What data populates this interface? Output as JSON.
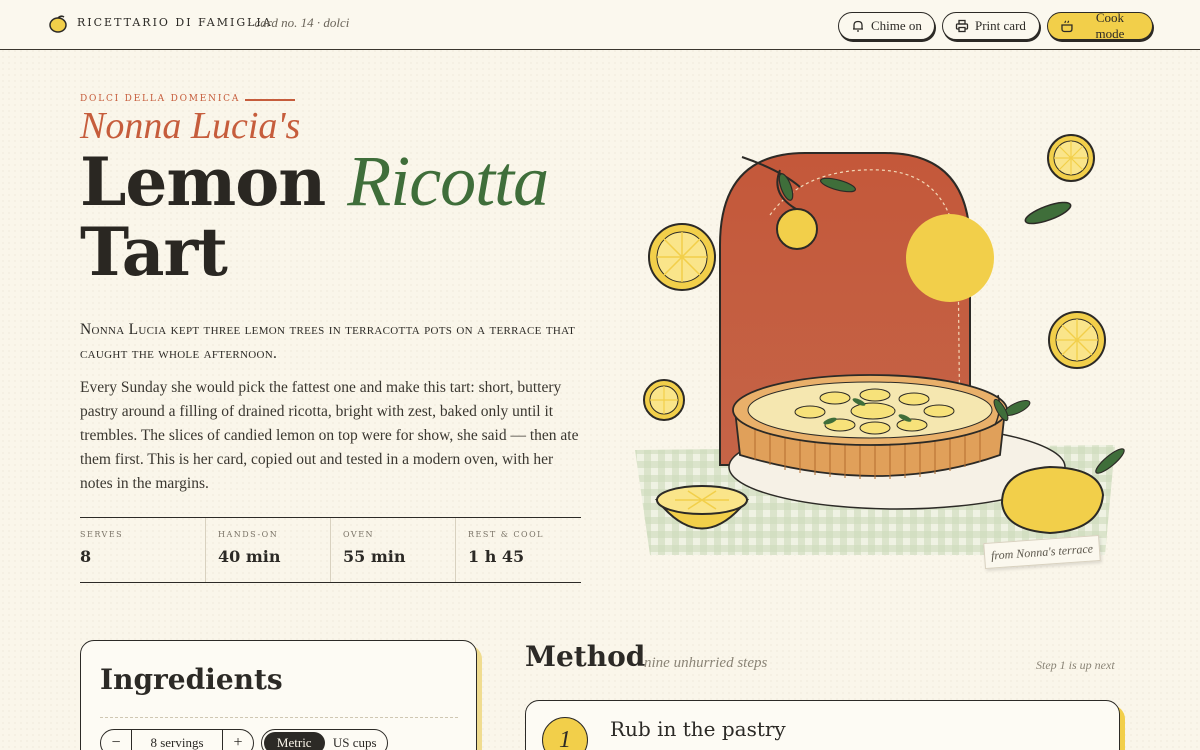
{
  "colors": {
    "accent_terracotta": "#c65d3c",
    "accent_green": "#3f6e3a",
    "lemon_yellow": "#f2cf4a",
    "ink": "#2c2a26",
    "paper": "#faf6ea"
  },
  "header": {
    "brand_icon": "lemon-icon",
    "brand_name": "RICETTARIO DI FAMIGLIA",
    "card_label": "· card no. 14 · dolci",
    "buttons": {
      "chime": {
        "label": "Chime on",
        "icon": "bell-icon"
      },
      "print": {
        "label": "Print card",
        "icon": "printer-icon"
      },
      "cook": {
        "label": "Cook mode",
        "icon": "pot-icon"
      }
    }
  },
  "hero": {
    "eyebrow": "DOLCI DELLA DOMENICA",
    "title_prefix": "Nonna Lucia's",
    "title_word1": "Lemon",
    "title_accent": "Ricotta",
    "title_word3": "Tart",
    "lead": "Nonna Lucia kept three lemon trees in terracotta pots on a terrace that caught the whole afternoon.",
    "body": "Every Sunday she would pick the fattest one and make this tart: short, buttery pastry around a filling of drained ricotta, bright with zest, baked only until it trembles. The slices of candied lemon on top were for show, she said — then ate them first. This is her card, copied out and tested in a modern oven, with her notes in the margins.",
    "illustration_caption": "from Nonna's terrace"
  },
  "stats": [
    {
      "label": "SERVES",
      "value": "8"
    },
    {
      "label": "HANDS-ON",
      "value": "40 min"
    },
    {
      "label": "OVEN",
      "value": "55 min"
    },
    {
      "label": "REST & COOL",
      "value": "1 h 45"
    }
  ],
  "ingredients": {
    "title": "Ingredients",
    "servings": {
      "minus": "−",
      "value": "8 servings",
      "plus": "+"
    },
    "units": {
      "active": "Metric",
      "other": "US cups"
    }
  },
  "method": {
    "title": "Method",
    "subtitle": "nine unhurried steps",
    "status": "Step 1 is up next",
    "steps": [
      {
        "number": "1",
        "title": "Rub in the pastry"
      }
    ]
  }
}
